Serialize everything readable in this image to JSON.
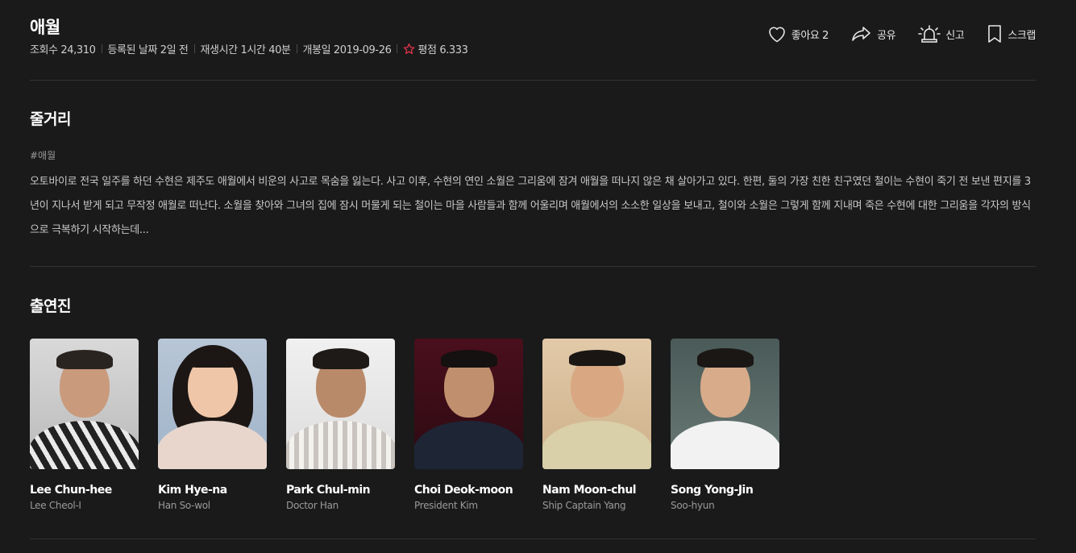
{
  "movie": {
    "title": "애월",
    "meta": {
      "views": "조회수 24,310",
      "registered": "등록된 날짜 2일 전",
      "runtime": "재생시간 1시간 40분",
      "release": "개봉일 2019-09-26",
      "rating": "평점 6.333"
    }
  },
  "actions": {
    "like": "좋아요 2",
    "share": "공유",
    "report": "신고",
    "scrap": "스크랩"
  },
  "synopsis": {
    "heading": "줄거리",
    "hashtag": "#애월",
    "text": "오토바이로 전국 일주를 하던 수현은 제주도 애월에서 비운의 사고로 목숨을 잃는다. 사고 이후, 수현의 연인 소월은 그리움에 잠겨 애월을 떠나지 않은 채 살아가고 있다. 한편, 둘의 가장 친한 친구였던 철이는 수현이 죽기 전 보낸 편지를 3년이 지나서 받게 되고 무작정 애월로 떠난다. 소월을 찾아와 그녀의 집에 잠시 머물게 되는 철이는 마을 사람들과 함께 어울리며 애월에서의 소소한 일상을 보내고, 철이와 소월은 그렇게 함께 지내며 죽은 수현에 대한 그리움을 각자의 방식으로 극복하기 시작하는데..."
  },
  "cast": {
    "heading": "출연진",
    "members": [
      {
        "name": "Lee Chun-hee",
        "role": "Lee Cheol-I"
      },
      {
        "name": "Kim Hye-na",
        "role": "Han So-wol"
      },
      {
        "name": "Park Chul-min",
        "role": "Doctor Han"
      },
      {
        "name": "Choi Deok-moon",
        "role": "President Kim"
      },
      {
        "name": "Nam Moon-chul",
        "role": "Ship Captain Yang"
      },
      {
        "name": "Song Yong-Jin",
        "role": "Soo-hyun"
      }
    ]
  },
  "colors": {
    "background": "#1a1a1b",
    "star": "#e8334a"
  },
  "icons": [
    "heart-icon",
    "share-icon",
    "siren-icon",
    "bookmark-icon",
    "star-icon"
  ]
}
